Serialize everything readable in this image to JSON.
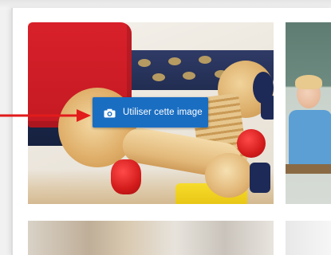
{
  "gallery": {
    "use_image_button": {
      "label": "Utiliser cette image",
      "icon": "camera-icon",
      "color": "#1a6ec2"
    },
    "tiles": [
      {
        "subject": "wooden-toys"
      },
      {
        "subject": "classroom-child"
      },
      {
        "subject": "classroom"
      },
      {
        "subject": "partial"
      }
    ]
  },
  "annotation": {
    "arrow_color": "#e21b1b"
  }
}
